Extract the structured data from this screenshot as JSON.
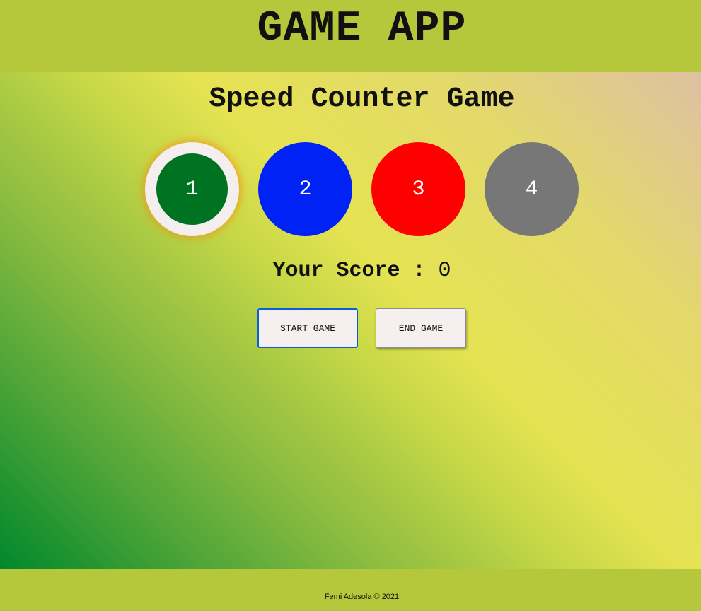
{
  "header": {
    "title": "GAME APP"
  },
  "game": {
    "title": "Speed Counter Game",
    "circles": [
      {
        "label": "1",
        "color": "#007322",
        "active": true
      },
      {
        "label": "2",
        "color": "#0022f5",
        "active": false
      },
      {
        "label": "3",
        "color": "#ff0000",
        "active": false
      },
      {
        "label": "4",
        "color": "#777777",
        "active": false
      }
    ],
    "score_label": "Your Score :",
    "score_value": "0",
    "start_label": "START GAME",
    "end_label": "END GAME"
  },
  "footer": {
    "credit": "Femi Adesola © 2021"
  },
  "colors": {
    "header_bg": "#b5c73a",
    "active_ring": "#f4eeee",
    "focus_border": "#0b5fd1"
  }
}
